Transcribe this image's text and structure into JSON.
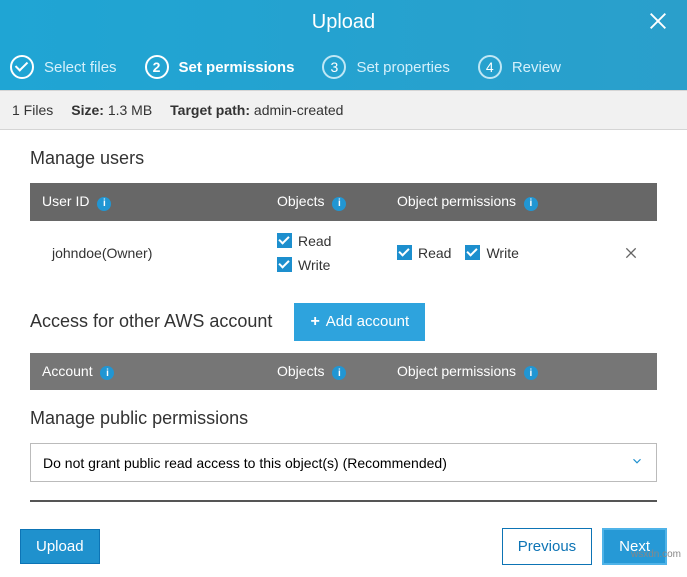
{
  "header": {
    "title": "Upload"
  },
  "steps": [
    {
      "label": "Select files",
      "state": "done",
      "num": ""
    },
    {
      "label": "Set permissions",
      "state": "active",
      "num": "2"
    },
    {
      "label": "Set properties",
      "state": "pending",
      "num": "3"
    },
    {
      "label": "Review",
      "state": "pending",
      "num": "4"
    }
  ],
  "infobar": {
    "files_count": "1 Files",
    "size_label": "Size:",
    "size_value": "1.3 MB",
    "target_label": "Target path:",
    "target_value": "admin-created"
  },
  "manage_users": {
    "title": "Manage users",
    "headers": {
      "user_id": "User ID",
      "objects": "Objects",
      "object_permissions": "Object permissions"
    },
    "rows": [
      {
        "user": "johndoe(Owner)",
        "objects": {
          "read": "Read",
          "write": "Write"
        },
        "permissions": {
          "read": "Read",
          "write": "Write"
        }
      }
    ]
  },
  "other_account": {
    "title": "Access for other AWS account",
    "add_button": "Add account",
    "headers": {
      "account": "Account",
      "objects": "Objects",
      "object_permissions": "Object permissions"
    }
  },
  "public_permissions": {
    "title": "Manage public permissions",
    "selected": "Do not grant public read access to this object(s) (Recommended)"
  },
  "footer": {
    "upload": "Upload",
    "previous": "Previous",
    "next": "Next"
  },
  "watermark": "wsxdn.com"
}
